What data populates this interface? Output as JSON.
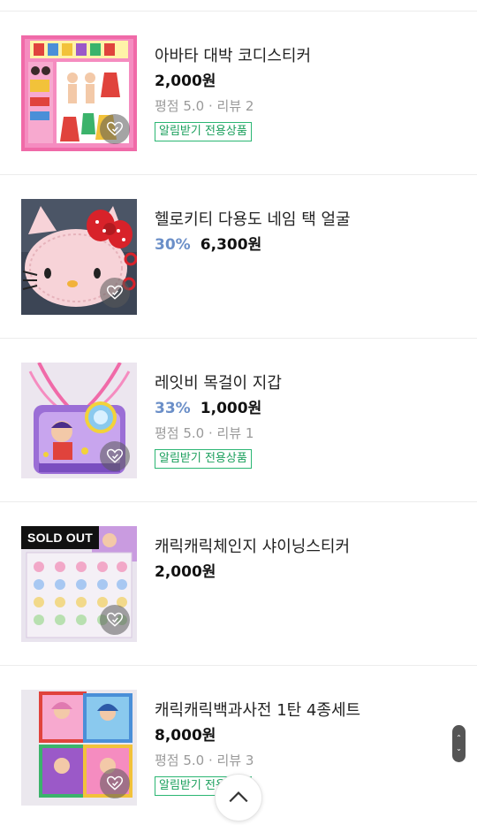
{
  "products": [
    {
      "title": "아바타 대박 코디스티커",
      "discount": "",
      "price": "2,000원",
      "rating": "평점 5.0 · 리뷰 2",
      "badge": "알림받기 전용상품",
      "sold_out": ""
    },
    {
      "title": "헬로키티 다용도 네임 택 얼굴",
      "discount": "30%",
      "price": "6,300원",
      "rating": "",
      "badge": "",
      "sold_out": ""
    },
    {
      "title": "레잇비 목걸이 지갑",
      "discount": "33%",
      "price": "1,000원",
      "rating": "평점 5.0 · 리뷰 1",
      "badge": "알림받기 전용상품",
      "sold_out": ""
    },
    {
      "title": "캐릭캐릭체인지 샤이닝스티커",
      "discount": "",
      "price": "2,000원",
      "rating": "",
      "badge": "",
      "sold_out": "SOLD OUT"
    },
    {
      "title": "캐릭캐릭백과사전 1탄 4종세트",
      "discount": "",
      "price": "8,000원",
      "rating": "평점 5.0 · 리뷰 3",
      "badge": "알림받기 전용상품",
      "sold_out": ""
    }
  ],
  "colors": {
    "discount": "#6b8fc8",
    "badge_border": "#2bb673",
    "divider": "#ececec"
  },
  "icons": {
    "wishlist": "heart-icon",
    "scroll_top": "chevron-up-icon"
  }
}
